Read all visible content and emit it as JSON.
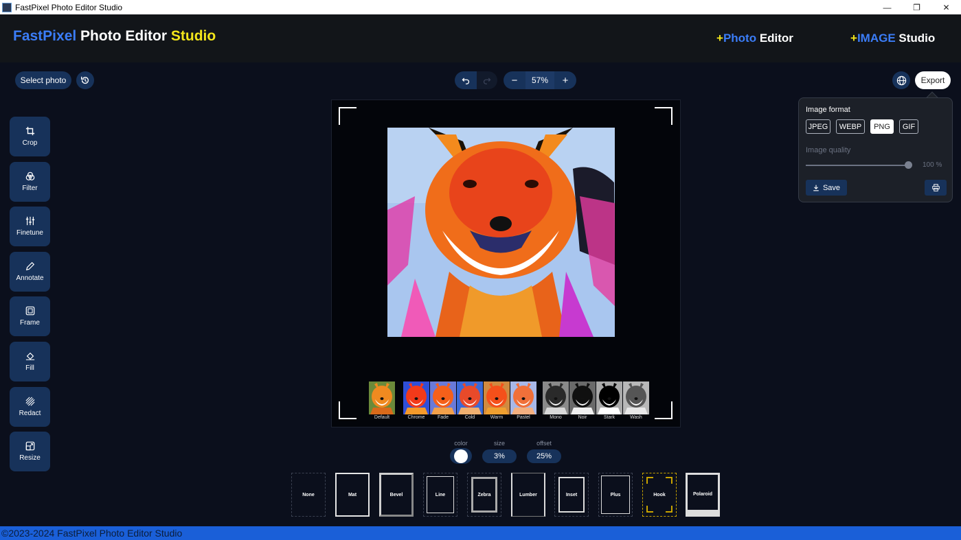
{
  "window": {
    "title": "FastPixel Photo Editor Studio"
  },
  "brand": {
    "part1": "FastPixel",
    "part2": " Photo Editor ",
    "part3": "Studio"
  },
  "header_links": [
    {
      "plus": "+",
      "accent": "Photo",
      "rest": " Editor"
    },
    {
      "plus": "+",
      "accent": "IMAGE",
      "rest": " Studio"
    }
  ],
  "topbar": {
    "select_photo": "Select photo",
    "zoom_out": "−",
    "zoom_level": "57%",
    "zoom_in": "+",
    "export": "Export"
  },
  "tools": [
    {
      "label": "Crop",
      "icon": "crop-icon"
    },
    {
      "label": "Filter",
      "icon": "filter-icon"
    },
    {
      "label": "Finetune",
      "icon": "sliders-icon"
    },
    {
      "label": "Annotate",
      "icon": "pencil-icon"
    },
    {
      "label": "Frame",
      "icon": "frame-icon"
    },
    {
      "label": "Fill",
      "icon": "fill-icon"
    },
    {
      "label": "Redact",
      "icon": "redact-icon"
    },
    {
      "label": "Resize",
      "icon": "resize-icon"
    }
  ],
  "filters": [
    "Default",
    "Chrome",
    "Fade",
    "Cold",
    "Warm",
    "Pastel",
    "Mono",
    "Noir",
    "Stark",
    "Wash"
  ],
  "export_panel": {
    "format_label": "Image format",
    "formats": [
      "JPEG",
      "WEBP",
      "PNG",
      "GIF"
    ],
    "selected_format": "PNG",
    "quality_label": "Image quality",
    "quality_value": "100 %",
    "quality_fraction": 1.0,
    "save": "Save"
  },
  "frame_controls": {
    "color_label": "color",
    "size_label": "size",
    "size_value": "3%",
    "offset_label": "offset",
    "offset_value": "25%"
  },
  "frames": [
    "None",
    "Mat",
    "Bevel",
    "Line",
    "Zebra",
    "Lumber",
    "Inset",
    "Plus",
    "Hook",
    "Polaroid"
  ],
  "footer": "©2023-2024 FastPixel Photo Editor Studio",
  "colors": {
    "accent_blue": "#3b7df8",
    "accent_yellow": "#f3e61b",
    "button_bg": "#17325a",
    "footer_bg": "#1a5fd8"
  }
}
